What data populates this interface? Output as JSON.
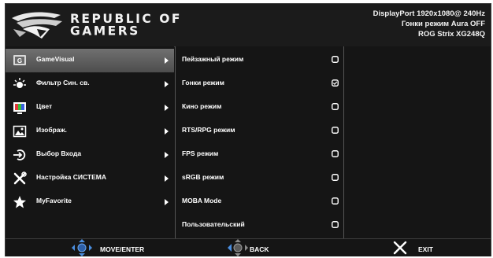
{
  "logo": {
    "line1": "REPUBLIC OF",
    "line2": "GAMERS",
    "icon": "rog-eye-logo"
  },
  "status": {
    "line1": "DisplayPort  1920x1080@  240Hz",
    "line2": "Гонки режим Aura OFF",
    "line3": "ROG Strix XG248Q"
  },
  "menu": [
    {
      "label": "GameVisual",
      "icon": "gamevisual-icon",
      "selected": true
    },
    {
      "label": "Фильтр Син. св.",
      "icon": "blue-light-filter-icon",
      "selected": false
    },
    {
      "label": "Цвет",
      "icon": "color-icon",
      "selected": false
    },
    {
      "label": "Изображ.",
      "icon": "image-icon",
      "selected": false
    },
    {
      "label": "Выбор Входа",
      "icon": "input-select-icon",
      "selected": false
    },
    {
      "label": "Настройка СИСТЕМА",
      "icon": "system-setup-icon",
      "selected": false
    },
    {
      "label": "MyFavorite",
      "icon": "star-icon",
      "selected": false
    }
  ],
  "submenu": [
    {
      "label": "Пейзажный режим",
      "checked": false
    },
    {
      "label": "Гонки режим",
      "checked": true
    },
    {
      "label": "Кино режим",
      "checked": false
    },
    {
      "label": "RTS/RPG режим",
      "checked": false
    },
    {
      "label": "FPS режим",
      "checked": false
    },
    {
      "label": "sRGB режим",
      "checked": false
    },
    {
      "label": "MOBA Mode",
      "checked": false
    },
    {
      "label": "Пользовательский",
      "checked": false
    }
  ],
  "footer": {
    "move": "MOVE/ENTER",
    "back": "BACK",
    "exit": "EXIT"
  }
}
